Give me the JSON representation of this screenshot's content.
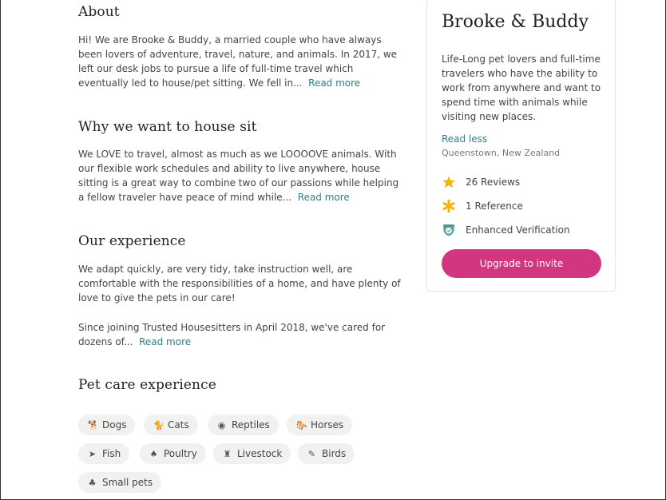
{
  "about": {
    "heading": "About",
    "text": "Hi! We are Brooke & Buddy, a married couple who have always been lovers of adventure, travel, nature, and animals. In 2017, we left our desk jobs to pursue a life of full-time travel which eventually led to house/pet sitting. We fell in...",
    "read_more": "Read more"
  },
  "why": {
    "heading": "Why we want to house sit",
    "text": "We LOVE to travel, almost as much as we LOOOOVE animals. With our flexible work schedules and ability to live anywhere, house sitting is a great way to combine two of our passions while helping a fellow traveler have peace of mind while...",
    "read_more": "Read more"
  },
  "experience": {
    "heading": "Our experience",
    "paragraph1": "We adapt quickly, are very tidy, take instruction well, are comfortable with the responsibilities of a home, and have plenty of love to give the pets in our care!",
    "paragraph2": "Since joining Trusted Housesitters in April 2018, we've cared for dozens of...",
    "read_more": "Read more"
  },
  "pet_care": {
    "heading": "Pet care experience",
    "pills": [
      {
        "label": "Dogs",
        "icon": "dog-icon",
        "glyph": "🐕"
      },
      {
        "label": "Cats",
        "icon": "cat-icon",
        "glyph": "🐈"
      },
      {
        "label": "Reptiles",
        "icon": "reptile-icon",
        "glyph": "◉"
      },
      {
        "label": "Horses",
        "icon": "horse-icon",
        "glyph": "🐎"
      },
      {
        "label": "Fish",
        "icon": "fish-icon",
        "glyph": "➤"
      },
      {
        "label": "Poultry",
        "icon": "poultry-icon",
        "glyph": "♠"
      },
      {
        "label": "Livestock",
        "icon": "livestock-icon",
        "glyph": "♜"
      },
      {
        "label": "Birds",
        "icon": "bird-icon",
        "glyph": "✎"
      },
      {
        "label": "Small pets",
        "icon": "small-pet-icon",
        "glyph": "♣"
      }
    ]
  },
  "profile": {
    "name": "Brooke & Buddy",
    "bio": "Life-Long pet lovers and full-time travelers who have the ability to work from anywhere and want to spend time with animals while visiting new places.",
    "read_less": "Read less",
    "location": "Queenstown, New Zealand",
    "reviews": "26 Reviews",
    "reference": "1 Reference",
    "verification": "Enhanced Verification",
    "cta": "Upgrade to invite",
    "colors": {
      "accent": "#d2367e",
      "link": "#2f7f82",
      "star": "#f4b400",
      "shield": "#5fa8a0"
    }
  }
}
